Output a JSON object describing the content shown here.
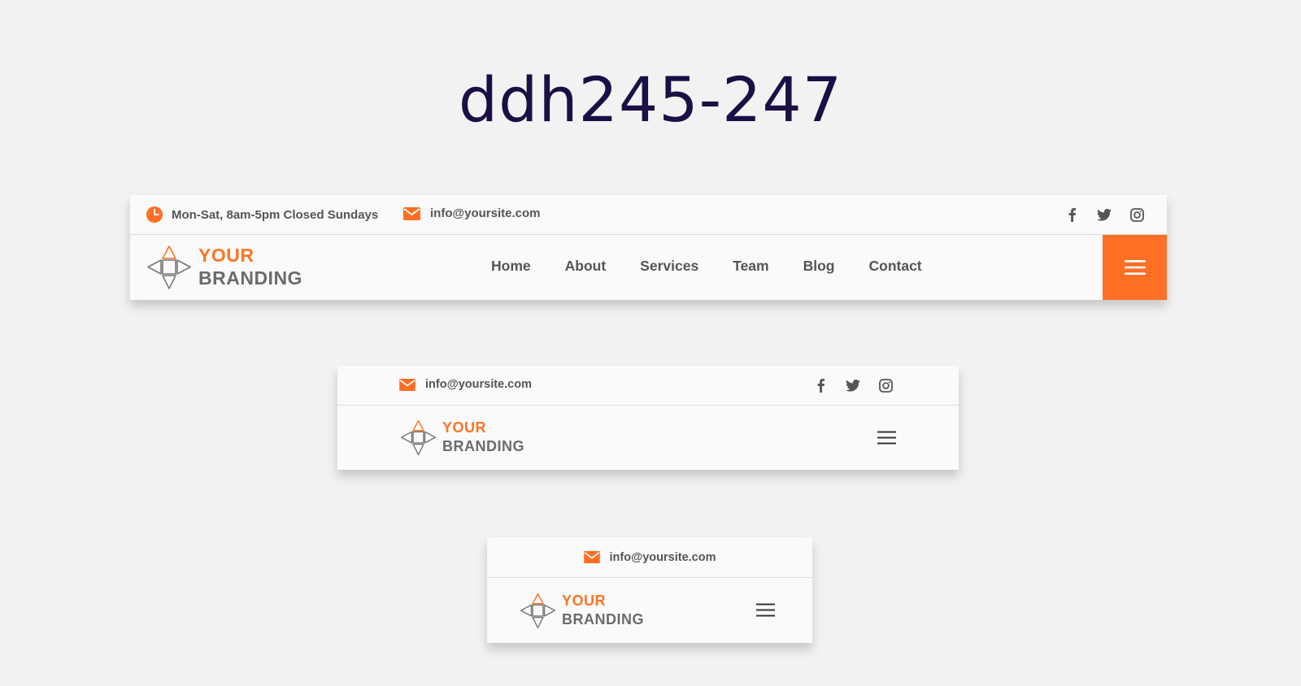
{
  "page": {
    "title": "ddh245-247"
  },
  "header_desktop": {
    "hours": "Mon-Sat, 8am-5pm Closed Sundays",
    "email": "info@yoursite.com",
    "logo_line1": "YOUR",
    "logo_line2": "BRANDING",
    "nav": [
      "Home",
      "About",
      "Services",
      "Team",
      "Blog",
      "Contact"
    ],
    "socials": [
      "facebook-icon",
      "twitter-icon",
      "instagram-icon"
    ]
  },
  "header_tablet": {
    "email": "info@yoursite.com",
    "logo_line1": "YOUR",
    "logo_line2": "BRANDING",
    "socials": [
      "facebook-icon",
      "twitter-icon",
      "instagram-icon"
    ]
  },
  "header_mobile": {
    "email": "info@yoursite.com",
    "logo_line1": "YOUR",
    "logo_line2": "BRANDING"
  },
  "colors": {
    "accent": "#ff6f26",
    "title": "#1b0f45",
    "background": "#f2f2f2",
    "header_bg": "#fafafa",
    "text": "#555555"
  }
}
